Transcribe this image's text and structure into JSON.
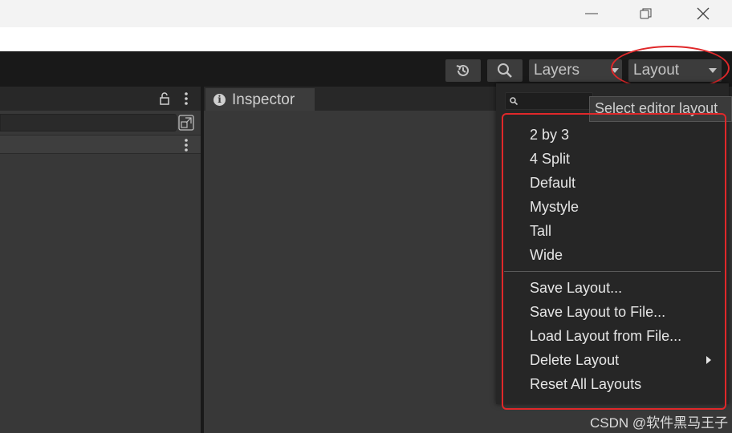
{
  "toolbar": {
    "layers_label": "Layers",
    "layout_label": "Layout"
  },
  "inspector": {
    "tab_label": "Inspector"
  },
  "layout_menu": {
    "tooltip": "Select editor layout",
    "layouts": [
      "2 by 3",
      "4 Split",
      "Default",
      "Mystyle",
      "Tall",
      "Wide"
    ],
    "actions": [
      "Save Layout...",
      "Save Layout to File...",
      "Load Layout from File...",
      "Delete Layout",
      "Reset All Layouts"
    ]
  },
  "watermark": "CSDN @软件黑马王子",
  "colors": {
    "highlight_red": "#e0282a",
    "toolbar_bg": "#191919",
    "panel_bg": "#383838",
    "menu_bg": "#262626"
  }
}
